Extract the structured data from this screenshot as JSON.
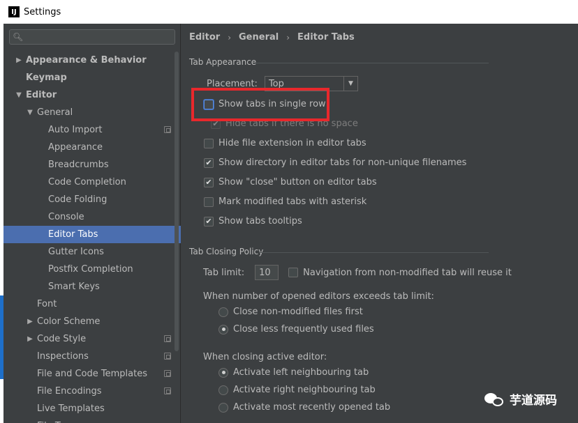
{
  "window": {
    "title": "Settings",
    "app_icon": "IJ"
  },
  "search": {
    "placeholder": ""
  },
  "sidebar": {
    "items": [
      {
        "label": "Appearance & Behavior",
        "arrow": "▶",
        "level": 0,
        "bold": true
      },
      {
        "label": "Keymap",
        "arrow": "",
        "level": 0,
        "bold": true
      },
      {
        "label": "Editor",
        "arrow": "▼",
        "level": 0,
        "bold": true
      },
      {
        "label": "General",
        "arrow": "▼",
        "level": 1
      },
      {
        "label": "Auto Import",
        "arrow": "",
        "level": 2,
        "copy": true
      },
      {
        "label": "Appearance",
        "arrow": "",
        "level": 2
      },
      {
        "label": "Breadcrumbs",
        "arrow": "",
        "level": 2
      },
      {
        "label": "Code Completion",
        "arrow": "",
        "level": 2
      },
      {
        "label": "Code Folding",
        "arrow": "",
        "level": 2
      },
      {
        "label": "Console",
        "arrow": "",
        "level": 2
      },
      {
        "label": "Editor Tabs",
        "arrow": "",
        "level": 2,
        "selected": true
      },
      {
        "label": "Gutter Icons",
        "arrow": "",
        "level": 2
      },
      {
        "label": "Postfix Completion",
        "arrow": "",
        "level": 2
      },
      {
        "label": "Smart Keys",
        "arrow": "",
        "level": 2
      },
      {
        "label": "Font",
        "arrow": "",
        "level": 1
      },
      {
        "label": "Color Scheme",
        "arrow": "▶",
        "level": 1
      },
      {
        "label": "Code Style",
        "arrow": "▶",
        "level": 1,
        "copy": true
      },
      {
        "label": "Inspections",
        "arrow": "",
        "level": 1,
        "copy": true
      },
      {
        "label": "File and Code Templates",
        "arrow": "",
        "level": 1,
        "copy": true
      },
      {
        "label": "File Encodings",
        "arrow": "",
        "level": 1,
        "copy": true
      },
      {
        "label": "Live Templates",
        "arrow": "",
        "level": 1
      },
      {
        "label": "File Types",
        "arrow": "",
        "level": 1
      }
    ]
  },
  "breadcrumb": {
    "items": [
      "Editor",
      "General",
      "Editor Tabs"
    ],
    "separator": "›"
  },
  "tab_appearance": {
    "title": "Tab Appearance",
    "placement_label": "Placement:",
    "placement_value": "Top",
    "options": [
      {
        "label": "Show tabs in single row",
        "checked": false
      },
      {
        "label": "Hide tabs if there is no space",
        "checked": true,
        "disabled": true
      },
      {
        "label": "Hide file extension in editor tabs",
        "checked": false
      },
      {
        "label": "Show directory in editor tabs for non-unique filenames",
        "checked": true
      },
      {
        "label": "Show \"close\" button on editor tabs",
        "checked": true
      },
      {
        "label": "Mark modified tabs with asterisk",
        "checked": false
      },
      {
        "label": "Show tabs tooltips",
        "checked": true
      }
    ]
  },
  "tab_closing": {
    "title": "Tab Closing Policy",
    "tab_limit_label": "Tab limit:",
    "tab_limit_value": "10",
    "navigation_label": "Navigation from non-modified tab will reuse it",
    "exceeds_label": "When number of opened editors exceeds tab limit:",
    "exceeds_options": [
      {
        "label": "Close non-modified files first",
        "selected": false
      },
      {
        "label": "Close less frequently used files",
        "selected": true
      }
    ],
    "closing_label": "When closing active editor:",
    "closing_options": [
      {
        "label": "Activate left neighbouring tab",
        "selected": true
      },
      {
        "label": "Activate right neighbouring tab",
        "selected": false
      },
      {
        "label": "Activate most recently opened tab",
        "selected": false
      }
    ]
  },
  "watermark": {
    "text": "芋道源码",
    "icon": "wechat-icon"
  },
  "colors": {
    "background": "#3c3f41",
    "selection": "#4b6eaf",
    "highlight_box": "#e8282c"
  }
}
